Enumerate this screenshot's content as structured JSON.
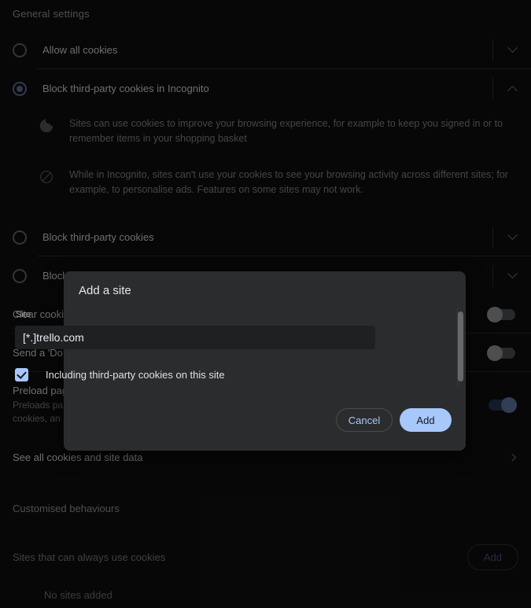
{
  "page": {
    "general_section_title": "General settings",
    "customised_section_title": "Customised behaviours"
  },
  "cookie_options": [
    {
      "label": "Allow all cookies",
      "selected": false,
      "expanded": false,
      "chevron": "chevron-down-icon"
    },
    {
      "label": "Block third-party cookies in Incognito",
      "selected": true,
      "expanded": true,
      "chevron": "chevron-up-icon"
    },
    {
      "label": "Block third-party cookies",
      "selected": false,
      "expanded": false,
      "chevron": "chevron-down-icon"
    },
    {
      "label": "Block",
      "selected": false,
      "expanded": false,
      "chevron": "chevron-down-icon"
    }
  ],
  "expanded_details": [
    {
      "icon": "cookie-icon",
      "text": "Sites can use cookies to improve your browsing experience, for example to keep you signed in or to remember items in your shopping basket"
    },
    {
      "icon": "block-circle-slash-icon",
      "text": "While in Incognito, sites can't use your cookies to see your browsing activity across different sites; for example, to personalise ads. Features on some sites may not work."
    }
  ],
  "toggle_rows": [
    {
      "title": "Clear cooki",
      "subtitle": "",
      "on": false
    },
    {
      "title": "Send a 'Do",
      "subtitle": "",
      "on": false
    },
    {
      "title": "Preload pag",
      "subtitle": "Preloads pa\ncookies, an",
      "on": true
    }
  ],
  "see_all_row": {
    "label": "See all cookies and site data",
    "arrow": "chevron-right-icon"
  },
  "always_allow": {
    "label": "Sites that can always use cookies",
    "add_label": "Add",
    "empty_text": "No sites added"
  },
  "dialog": {
    "title": "Add a site",
    "field_label": "Site",
    "site_value": "[*.]trello.com",
    "site_placeholder": "",
    "checkbox_label": "Including third-party cookies on this site",
    "checkbox_checked": true,
    "cancel_label": "Cancel",
    "add_label": "Add"
  },
  "colors": {
    "page_bg": "#0e0e0e",
    "dialog_bg": "#2b2c2e",
    "accent_blue": "#a8c7fa",
    "radio_selected": "#5c6b91",
    "toggle_on": "#5d7099"
  }
}
